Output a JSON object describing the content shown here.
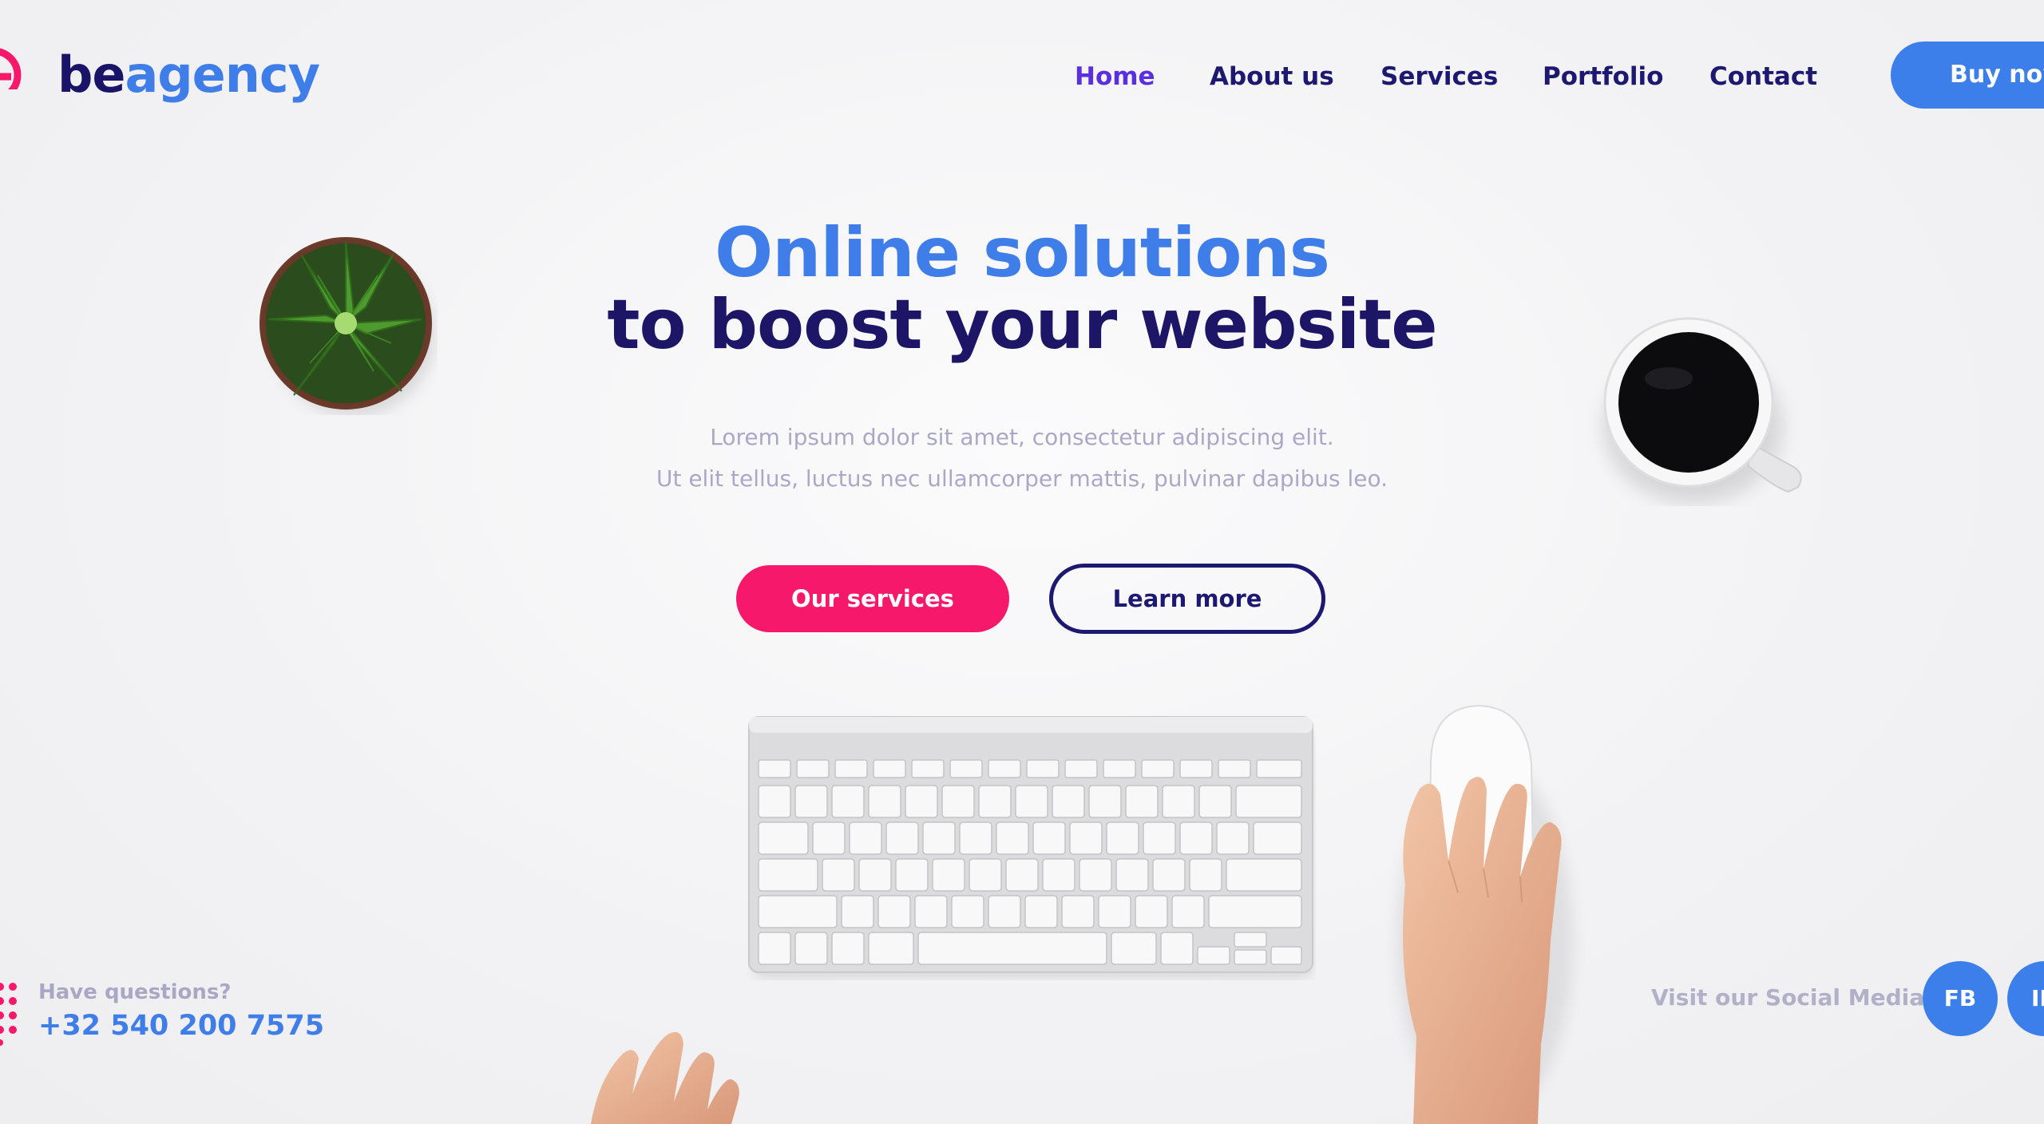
{
  "brand": {
    "name_part1": "be",
    "name_part2": "agency",
    "logo_icon": "e-circle-logo-icon",
    "colors": {
      "primary_blue": "#3f7de8",
      "navy": "#1d1870",
      "pink": "#f6196b",
      "active_nav": "#5a2fe0"
    }
  },
  "nav": {
    "items": [
      {
        "label": "Home",
        "active": true
      },
      {
        "label": "About us",
        "active": false
      },
      {
        "label": "Services",
        "active": false
      },
      {
        "label": "Portfolio",
        "active": false
      },
      {
        "label": "Contact",
        "active": false
      }
    ],
    "cta_label": "Buy now"
  },
  "hero": {
    "headline_line1": "Online solutions",
    "headline_line2": "to boost your website",
    "sub_line1": "Lorem ipsum dolor sit amet, consectetur adipiscing elit.",
    "sub_line2": "Ut elit tellus, luctus nec ullamcorper mattis, pulvinar dapibus leo.",
    "primary_button": "Our services",
    "secondary_button": "Learn more"
  },
  "contact": {
    "question": "Have questions?",
    "phone": "+32 540 200 7575",
    "icon": "dots-grid-icon"
  },
  "social": {
    "label": "Visit our Social Media",
    "buttons": [
      {
        "label": "FB"
      },
      {
        "label": "IN"
      }
    ]
  }
}
